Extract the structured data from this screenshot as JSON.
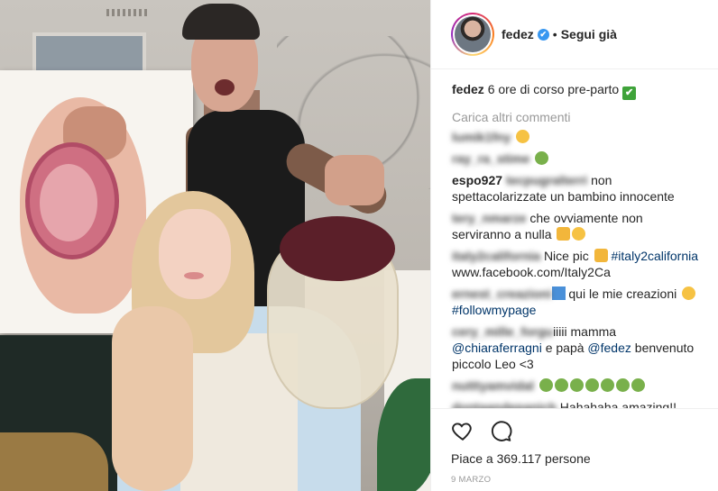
{
  "post": {
    "username": "fedez",
    "verified_mark": "✔",
    "separator": "•",
    "follow_label": "Segui già"
  },
  "caption": {
    "username": "fedez",
    "text": "6 ore di corso pre-parto",
    "emoji": "✔"
  },
  "load_more_label": "Carica altri commenti",
  "comments": [
    {
      "user": "lumik1fny",
      "text": ""
    },
    {
      "user": "ray_ra_stime",
      "text": ""
    },
    {
      "user": "espo927",
      "hidden_mid": "tecpugralterri",
      "text": "non spettacolarizzate un bambino innocente"
    },
    {
      "user": "tery_nmarze",
      "text": "che ovviamente non serviranno a nulla"
    },
    {
      "user": "italy2california",
      "text": "Nice pic",
      "hashtag": "#italy2california",
      "link": "www.facebook.com/Italy2Ca"
    },
    {
      "user": "ernest_creazioni",
      "text": "qui le mie creazioni",
      "hashtag": "#followmypage"
    },
    {
      "user": "cery_mille_forgu",
      "text": "iiiii mamma",
      "mention1": "@chiaraferragni",
      "mid": "e papà",
      "mention2": "@fedez",
      "tail": "benvenuto piccolo Leo <3"
    },
    {
      "user": "nutttyamvidal",
      "text": ""
    },
    {
      "user": "dontaandepanich",
      "text": "Hahahaha amazing!! Enjoy"
    }
  ],
  "actions": {
    "likes_text": "Piace a 369.117 persone",
    "date_text": "9 MARZO"
  },
  "colors": {
    "link": "#003569",
    "muted": "#999999",
    "text": "#262626",
    "verified": "#3897f0"
  },
  "icons": [
    "heart-icon",
    "comment-icon",
    "verified-badge-icon"
  ]
}
